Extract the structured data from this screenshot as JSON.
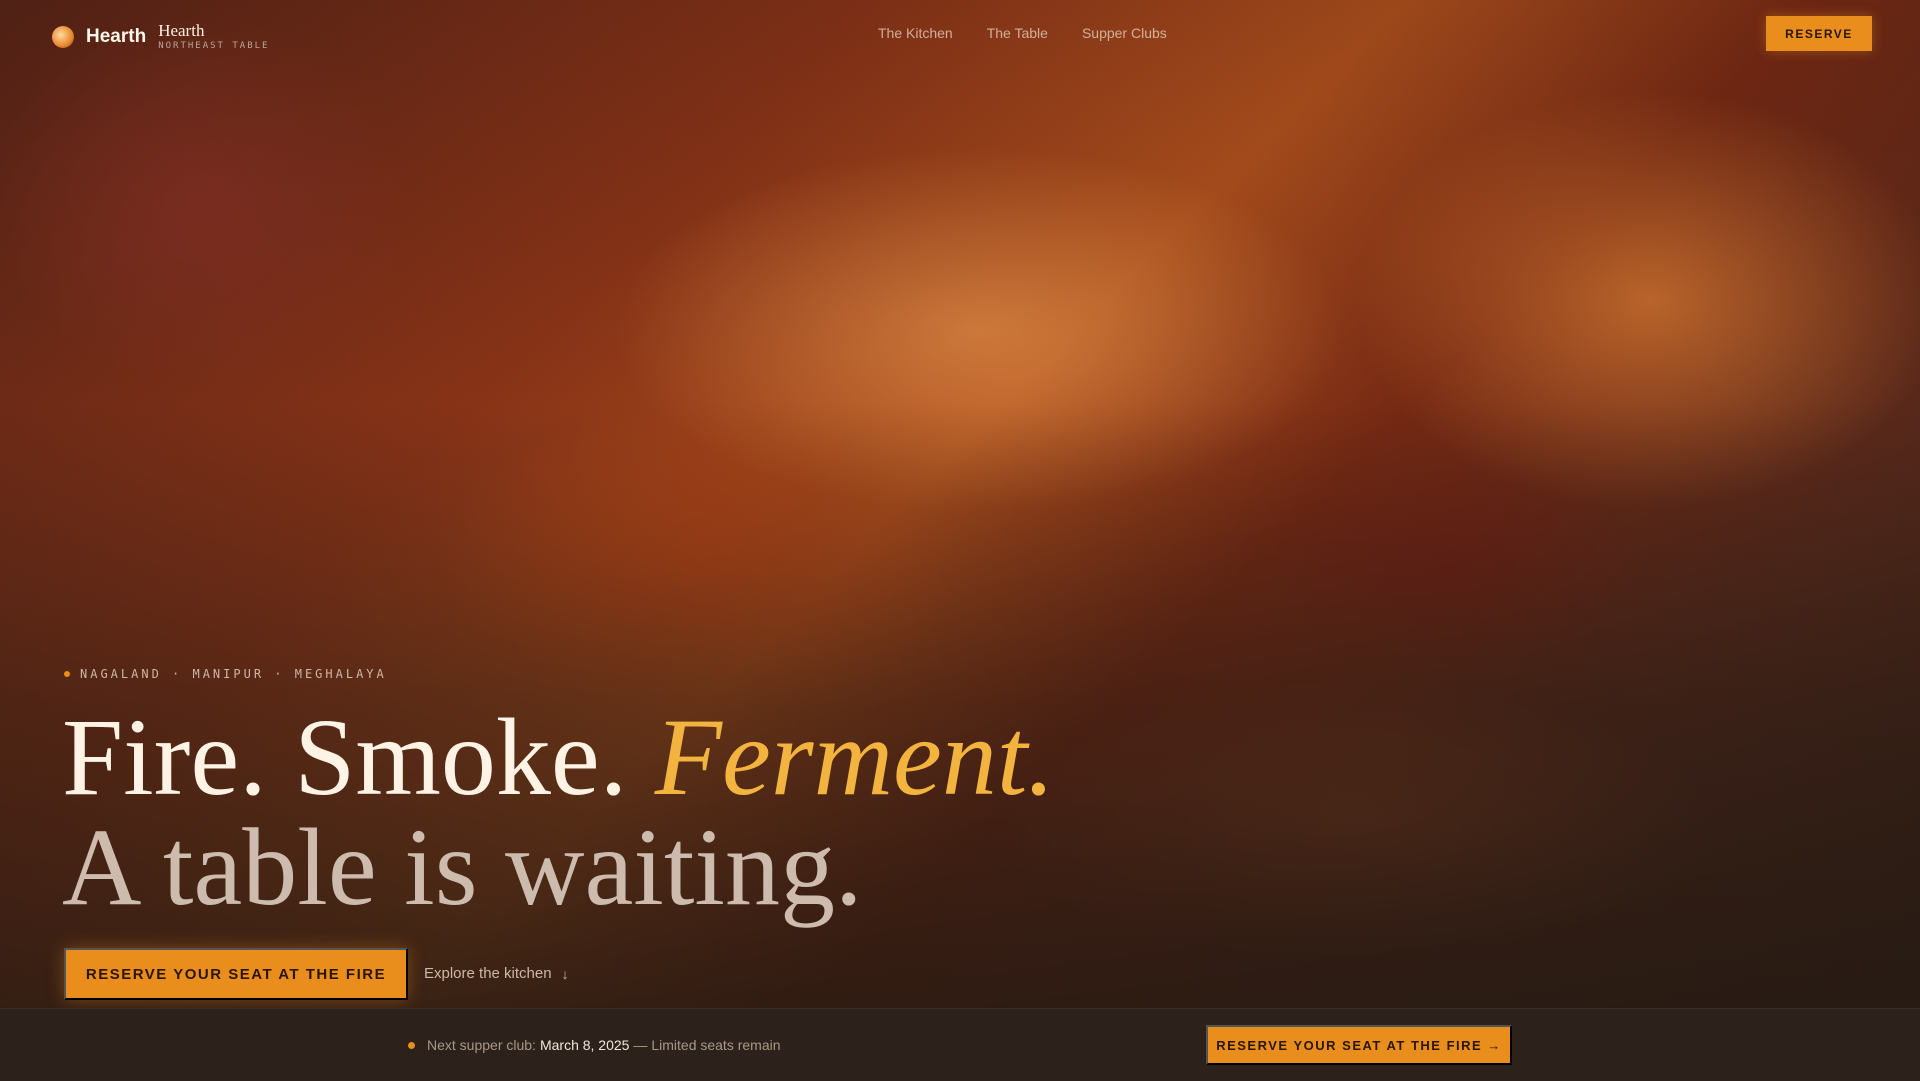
{
  "nav": {
    "logo_text": "Hearth",
    "brand_name": "Hearth",
    "brand_sub": "NORTHEAST TABLE",
    "links": [
      "The Kitchen",
      "The Table",
      "Supper Clubs"
    ],
    "reserve_label": "RESERVE"
  },
  "hero": {
    "regions": "NAGALAND · MANIPUR · MEGHALAYA",
    "headline_part1": "Fire. Smoke.",
    "headline_accent": "Ferment.",
    "headline_line2": "A table is waiting.",
    "cta_label": "RESERVE YOUR SEAT AT THE FIRE",
    "explore_label": "Explore the kitchen",
    "explore_icon": "arrow-down-icon"
  },
  "bottom_bar": {
    "prefix": "Next supper club:",
    "date": "March 8, 2025",
    "suffix": "— Limited seats remain",
    "cta_label": "RESERVE YOUR SEAT AT THE FIRE →"
  },
  "colors": {
    "accent": "#e98d1d",
    "headline_accent": "#f2b43e",
    "bar_bg": "#2c221b"
  }
}
